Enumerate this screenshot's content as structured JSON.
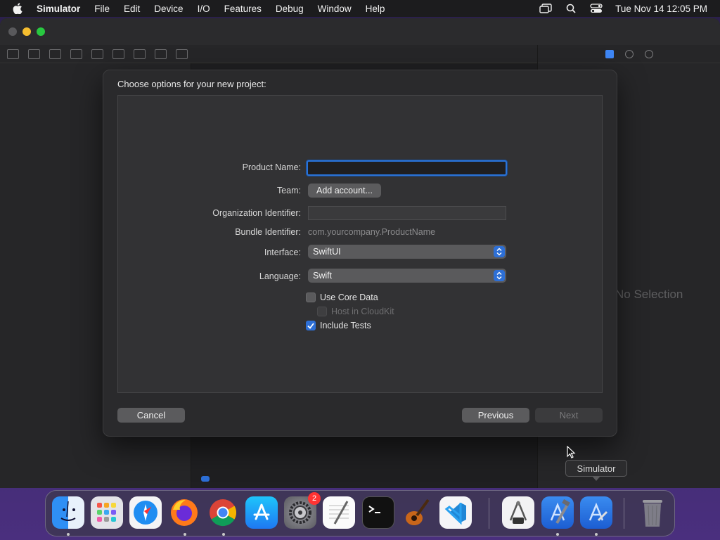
{
  "menubar": {
    "app_name": "Simulator",
    "items": [
      "File",
      "Edit",
      "Device",
      "I/O",
      "Features",
      "Debug",
      "Window",
      "Help"
    ],
    "clock": "Tue Nov 14  12:05 PM"
  },
  "xcode": {
    "no_selection_text": "No Selection"
  },
  "sheet": {
    "title": "Choose options for your new project:",
    "fields": {
      "product_name_label": "Product Name:",
      "product_name_value": "",
      "team_label": "Team:",
      "team_button": "Add account...",
      "org_id_label": "Organization Identifier:",
      "org_id_value": "",
      "bundle_id_label": "Bundle Identifier:",
      "bundle_id_value": "com.yourcompany.ProductName",
      "interface_label": "Interface:",
      "interface_value": "SwiftUI",
      "language_label": "Language:",
      "language_value": "Swift"
    },
    "checkboxes": {
      "use_core_data": "Use Core Data",
      "use_core_data_checked": false,
      "host_in_cloudkit": "Host in CloudKit",
      "host_in_cloudkit_checked": false,
      "include_tests": "Include Tests",
      "include_tests_checked": true
    },
    "buttons": {
      "cancel": "Cancel",
      "previous": "Previous",
      "next": "Next"
    }
  },
  "tooltip": "Simulator",
  "dock": {
    "items": [
      {
        "name": "Finder",
        "icon": "finder-icon"
      },
      {
        "name": "Launchpad",
        "icon": "launchpad-icon"
      },
      {
        "name": "Safari",
        "icon": "safari-icon"
      },
      {
        "name": "Firefox",
        "icon": "firefox-icon"
      },
      {
        "name": "Chrome",
        "icon": "chrome-icon"
      },
      {
        "name": "App Store",
        "icon": "app-store-icon"
      },
      {
        "name": "System Settings",
        "icon": "settings-icon",
        "badge": "2"
      },
      {
        "name": "TextEdit",
        "icon": "textedit-icon"
      },
      {
        "name": "Terminal",
        "icon": "terminal-icon"
      },
      {
        "name": "GarageBand",
        "icon": "garageband-icon"
      },
      {
        "name": "Visual Studio Code",
        "icon": "vscode-icon"
      },
      {
        "name": "Instruments",
        "icon": "instruments-icon"
      },
      {
        "name": "Xcode",
        "icon": "xcode-icon"
      },
      {
        "name": "Simulator",
        "icon": "simulator-icon"
      },
      {
        "name": "Trash",
        "icon": "trash-icon"
      }
    ]
  },
  "colors": {
    "accent": "#2d6fd6",
    "focus_ring": "#2a73d8",
    "badge": "#ff3b30"
  }
}
